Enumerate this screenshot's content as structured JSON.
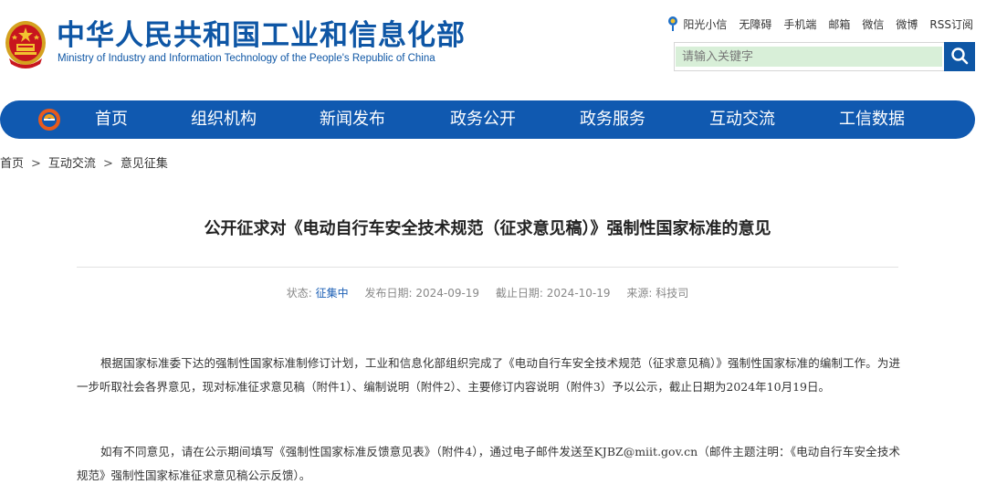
{
  "header": {
    "title_cn": "中华人民共和国工业和信息化部",
    "title_en": "Ministry of Industry and Information Technology of the People's Republic of China",
    "top_links": [
      "阳光小信",
      "无障碍",
      "手机端",
      "邮箱",
      "微信",
      "微博",
      "RSS订阅"
    ],
    "search_placeholder": "请输入关键字"
  },
  "nav": {
    "items": [
      "首页",
      "组织机构",
      "新闻发布",
      "政务公开",
      "政务服务",
      "互动交流",
      "工信数据"
    ]
  },
  "breadcrumb": [
    "首页",
    "互动交流",
    "意见征集"
  ],
  "article": {
    "title": "公开征求对《电动自行车安全技术规范（征求意见稿）》强制性国家标准的意见",
    "meta": {
      "status_label": "状态:",
      "status_value": "征集中",
      "publish_label": "发布日期:",
      "publish_date": "2024-09-19",
      "deadline_label": "截止日期:",
      "deadline_date": "2024-10-19",
      "source_label": "来源:",
      "source_value": "科技司"
    },
    "paragraphs": [
      "根据国家标准委下达的强制性国家标准制修订计划，工业和信息化部组织完成了《电动自行车安全技术规范（征求意见稿）》强制性国家标准的编制工作。为进一步听取社会各界意见，现对标准征求意见稿（附件1）、编制说明（附件2）、主要修订内容说明（附件3）予以公示，截止日期为2024年10月19日。",
      "如有不同意见，请在公示期间填写《强制性国家标准反馈意见表》（附件4），通过电子邮件发送至KJBZ@miit.gov.cn（邮件主题注明：《电动自行车安全技术规范》强制性国家标准征求意见稿公示反馈）。"
    ]
  },
  "colors": {
    "brand_blue": "#0e56a5",
    "nav_blue": "#1059b0",
    "search_bg": "#d8efd8",
    "status_blue": "#1b5fb5"
  }
}
